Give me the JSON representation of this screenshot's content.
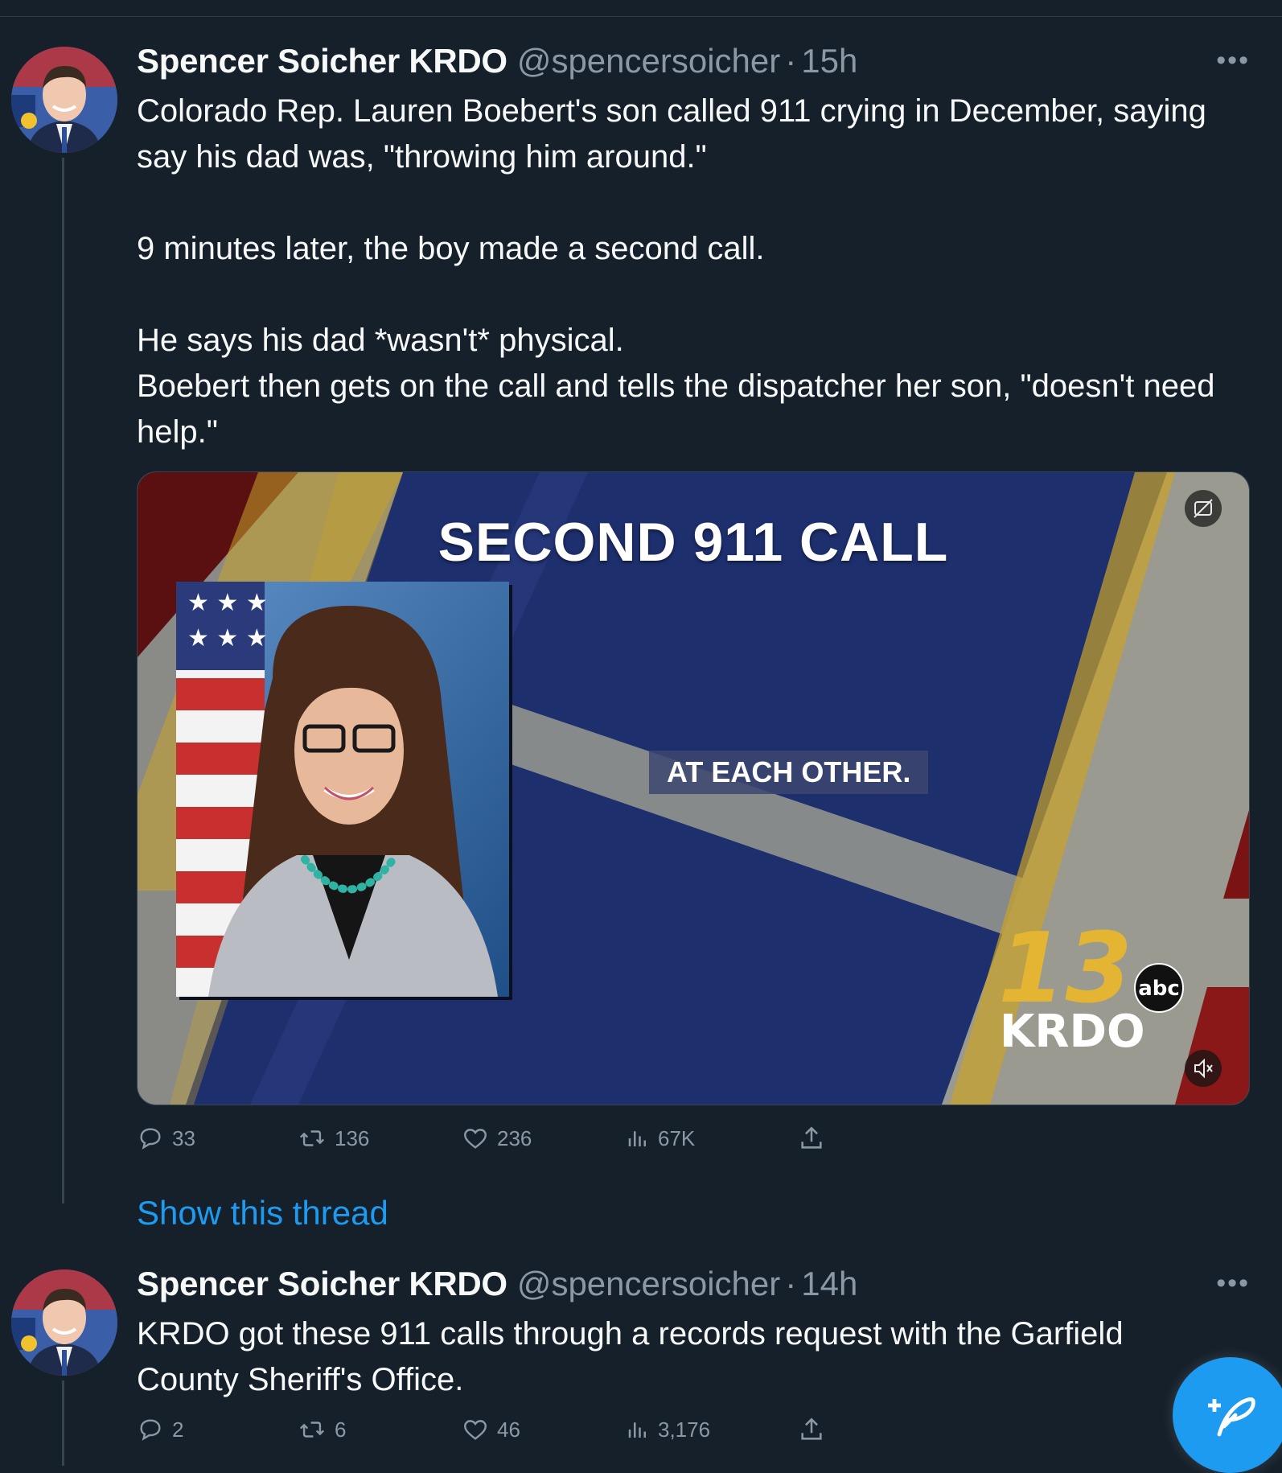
{
  "colors": {
    "background": "#15202b",
    "accent": "#1d9bf0",
    "muted": "#8b98a5"
  },
  "tweet1": {
    "author_name": "Spencer Soicher KRDO",
    "handle": "@spencersoicher",
    "separator": "·",
    "time": "15h",
    "more_icon": "more-horizontal-icon",
    "paragraphs": [
      "Colorado Rep. Lauren Boebert's son called 911 crying in December, saying say his dad was, \"throwing him around.\"",
      "9 minutes later, the boy made a second call.",
      "He says his dad *wasn't* physical.",
      "Boebert then gets on the call and tells the dispatcher her son, \"doesn't need help.\""
    ],
    "media": {
      "title": "SECOND 911 CALL",
      "caption": "AT EACH OTHER.",
      "logo_number": "13",
      "logo_network": "abc",
      "logo_station": "KRDO",
      "cc_icon": "closed-captions-off-icon",
      "mute_icon": "muted-speaker-icon"
    },
    "stats": {
      "replies": "33",
      "retweets": "136",
      "likes": "236",
      "views": "67K"
    }
  },
  "show_thread_label": "Show this thread",
  "tweet2": {
    "author_name": "Spencer Soicher KRDO",
    "handle": "@spencersoicher",
    "separator": "·",
    "time": "14h",
    "more_icon": "more-horizontal-icon",
    "text": "KRDO got these 911 calls through a records request with the Garfield County Sheriff's Office.",
    "stats": {
      "replies": "2",
      "retweets": "6",
      "likes": "46",
      "views": "3,176"
    }
  },
  "compose_icon": "compose-feather-icon"
}
